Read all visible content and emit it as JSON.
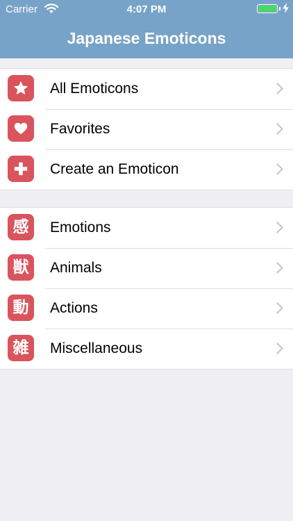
{
  "status_bar": {
    "carrier": "Carrier",
    "time": "4:07 PM",
    "battery_level": 1.0,
    "battery_color": "#4cd964"
  },
  "nav": {
    "title": "Japanese Emoticons",
    "background_color": "#77a3c8"
  },
  "accent_color": "#d9545c",
  "sections": [
    {
      "items": [
        {
          "label": "All Emoticons",
          "icon": "star-icon"
        },
        {
          "label": "Favorites",
          "icon": "heart-icon"
        },
        {
          "label": "Create an Emoticon",
          "icon": "plus-icon"
        }
      ]
    },
    {
      "items": [
        {
          "label": "Emotions",
          "icon": "kanji-emotion-icon",
          "glyph": "感"
        },
        {
          "label": "Animals",
          "icon": "kanji-animal-icon",
          "glyph": "獣"
        },
        {
          "label": "Actions",
          "icon": "kanji-action-icon",
          "glyph": "動"
        },
        {
          "label": "Miscellaneous",
          "icon": "kanji-misc-icon",
          "glyph": "雑"
        }
      ]
    }
  ]
}
